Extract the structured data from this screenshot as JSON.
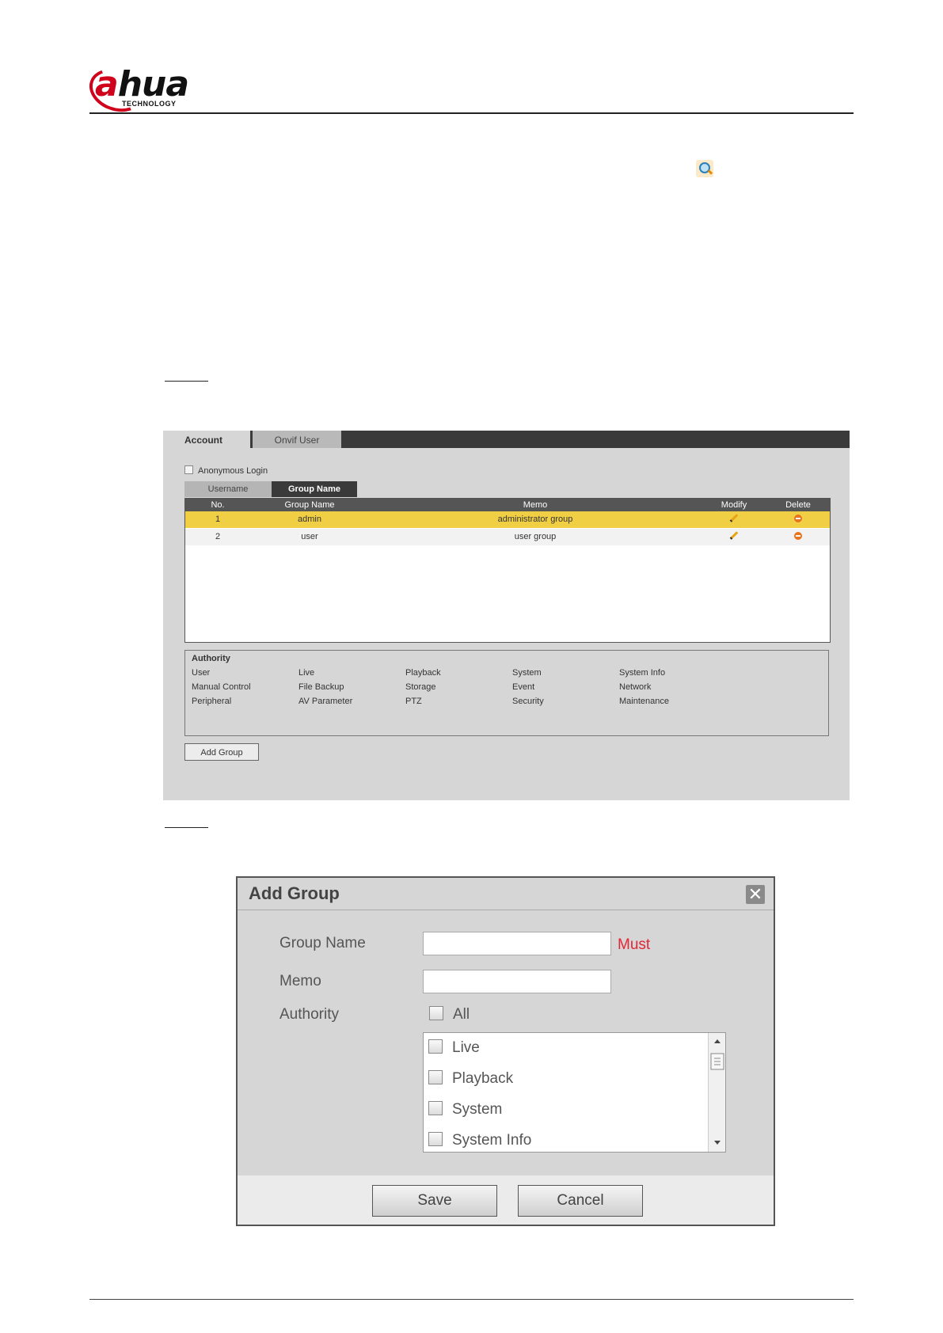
{
  "brand": {
    "logo_word_a": "a",
    "logo_word_rest": "hua",
    "logo_sub": "TECHNOLOGY",
    "accent": "#d0021b"
  },
  "icons": {
    "magnifier": "magnifier-icon"
  },
  "account_screen": {
    "tabs": [
      "Account",
      "Onvif User"
    ],
    "anonymous_login": "Anonymous Login",
    "subtabs": [
      "Username",
      "Group Name"
    ],
    "columns": [
      "No.",
      "Group Name",
      "Memo",
      "Modify",
      "Delete"
    ],
    "rows": [
      {
        "no": "1",
        "group": "admin",
        "memo": "administrator group"
      },
      {
        "no": "2",
        "group": "user",
        "memo": "user group"
      }
    ],
    "authority_title": "Authority",
    "authority_grid": [
      [
        "User",
        "Live",
        "Playback",
        "System",
        "System Info"
      ],
      [
        "Manual Control",
        "File Backup",
        "Storage",
        "Event",
        "Network"
      ],
      [
        "Peripheral",
        "AV Parameter",
        "PTZ",
        "Security",
        "Maintenance"
      ]
    ],
    "add_group_button": "Add Group",
    "highlight_color": "#f0cf45"
  },
  "add_group_dialog": {
    "title": "Add Group",
    "close_glyph": "✕",
    "group_name_label": "Group Name",
    "must_label": "Must",
    "memo_label": "Memo",
    "authority_label": "Authority",
    "all_label": "All",
    "authority_items": [
      "Live",
      "Playback",
      "System",
      "System Info"
    ],
    "save_button": "Save",
    "cancel_button": "Cancel"
  }
}
